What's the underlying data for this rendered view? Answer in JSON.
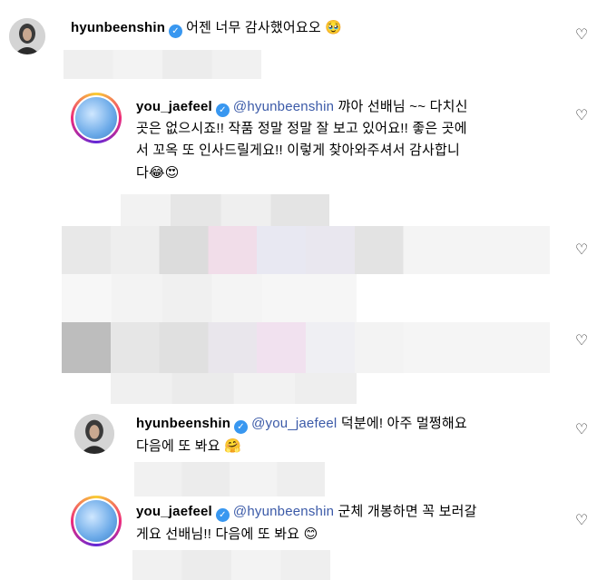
{
  "comments": [
    {
      "username": "hyunbeenshin",
      "mention": "",
      "text": "어젠 너무 감사했어요오",
      "emoji": "🥹",
      "verified_icon": "verified-badge-icon"
    },
    {
      "username": "you_jaefeel",
      "mention": "@hyunbeenshin",
      "text_lines": [
        "꺄아 선배님 ~~ 다치신",
        "곳은 없으시죠!! 작품 정말 정말 잘 보고 있어요!! 좋은 곳에",
        "서 꼬옥 또 인사드릴게요!! 이렇게 찾아와주셔서 감사합니",
        "다"
      ],
      "emoji": "😂😍"
    },
    {
      "username": "hyunbeenshin",
      "mention": "@you_jaefeel",
      "text_lines": [
        "덕분에! 아주 멀쩡해요",
        "다음에 또 봐요"
      ],
      "emoji": "🤗"
    },
    {
      "username": "you_jaefeel",
      "mention": "@hyunbeenshin",
      "text_lines": [
        "군체 개봉하면 꼭 보러갈",
        "게요 선배님!! 다음에 또 봐요"
      ],
      "emoji": "😊"
    }
  ],
  "icons": {
    "heart": "heart-outline-icon",
    "verified": "verified-badge-icon"
  },
  "colors": {
    "mention": "#3b5aa8",
    "verified": "#3897f0"
  }
}
